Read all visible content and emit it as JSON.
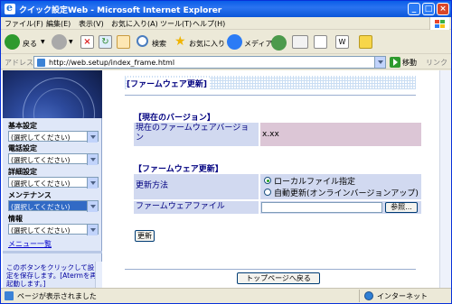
{
  "window": {
    "title": "クイック設定Web - Microsoft Internet Explorer"
  },
  "menubar": [
    "ファイル(F)",
    "編集(E)",
    "表示(V)",
    "お気に入り(A)",
    "ツール(T)",
    "ヘルプ(H)"
  ],
  "toolbar": {
    "back": "戻る",
    "search": "検索",
    "favorites": "お気に入り",
    "media": "メディア"
  },
  "address": {
    "label": "アドレス(D)",
    "url": "http://web.setup/index_frame.html",
    "go": "移動",
    "links": "リンク"
  },
  "sidebar": {
    "groups": [
      {
        "label": "基本設定",
        "value": "(選択してください)"
      },
      {
        "label": "電話設定",
        "value": "(選択してください)"
      },
      {
        "label": "詳細設定",
        "value": "(選択してください)"
      },
      {
        "label": "メンテナンス",
        "value": "(選択してください)"
      },
      {
        "label": "情報",
        "value": "(選択してください)"
      }
    ],
    "menu_link": "メニュー一覧",
    "note": "このボタンをクリックして設定を保存します。[Atermを再起動します。]"
  },
  "main": {
    "page_title": "[ファームウェア更新]",
    "current_section": "【現在のバージョン】",
    "current_label": "現在のファームウェアバージョン",
    "current_value": "x.xx",
    "update_section": "【ファームウェア更新】",
    "method_label": "更新方法",
    "method_options": [
      "ローカルファイル指定",
      "自動更新(オンラインバージョンアップ)"
    ],
    "file_label": "ファームウェアファイル",
    "browse_button": "参照...",
    "update_button": "更新",
    "top_button": "トップページへ戻る"
  },
  "status": {
    "text": "ページが表示されました",
    "zone": "インターネット"
  },
  "colors": {
    "title_bar": "#0a5ee8",
    "label_cell": "#d1d9f0",
    "value_cell": "#dcc6d6",
    "heading": "#000080"
  }
}
